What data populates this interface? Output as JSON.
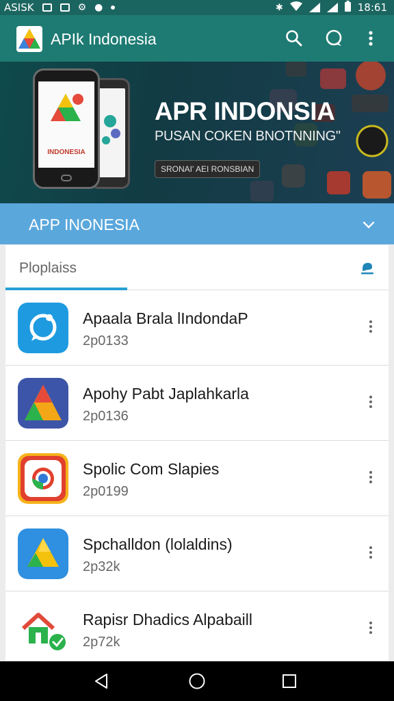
{
  "status_bar": {
    "carrier": "ASISK",
    "time": "18:61"
  },
  "app_bar": {
    "title": "APIk Indonesia",
    "icons": [
      "search-icon",
      "chat-icon",
      "more-vert-icon"
    ]
  },
  "banner": {
    "phone_label": "INDONESIA",
    "title": "APR INDONSIA",
    "subtitle": "PUSAN COKEN BNOTNNING\"",
    "button_label": "SRONAI' AEI RONSBIAN"
  },
  "section": {
    "title": "APP INONESIA",
    "chevron": "chevron-down-icon"
  },
  "tab": {
    "label": "Ploplaiss",
    "icon": "edit-icon"
  },
  "apps": [
    {
      "title": "Apaala Brala lIndondaP",
      "subtitle": "2p0133",
      "icon": "chat-bubble-icon"
    },
    {
      "title": "Apohy Pabt Japlahkarla",
      "subtitle": "2p0136",
      "icon": "triangle-logo-icon"
    },
    {
      "title": "Spolic Com Slapies",
      "subtitle": "2p0199",
      "icon": "chrome-icon"
    },
    {
      "title": "Spchalldon (lolaldins)",
      "subtitle": "2p32k",
      "icon": "drive-icon"
    },
    {
      "title": "Rapisr Dhadics Alpabaill",
      "subtitle": "2p72k",
      "icon": "home-check-icon"
    }
  ],
  "colors": {
    "status_bar": "#1b6560",
    "app_bar": "#1e7b73",
    "section_bar": "#5aa7dc",
    "tab_accent": "#2a9fd6"
  }
}
